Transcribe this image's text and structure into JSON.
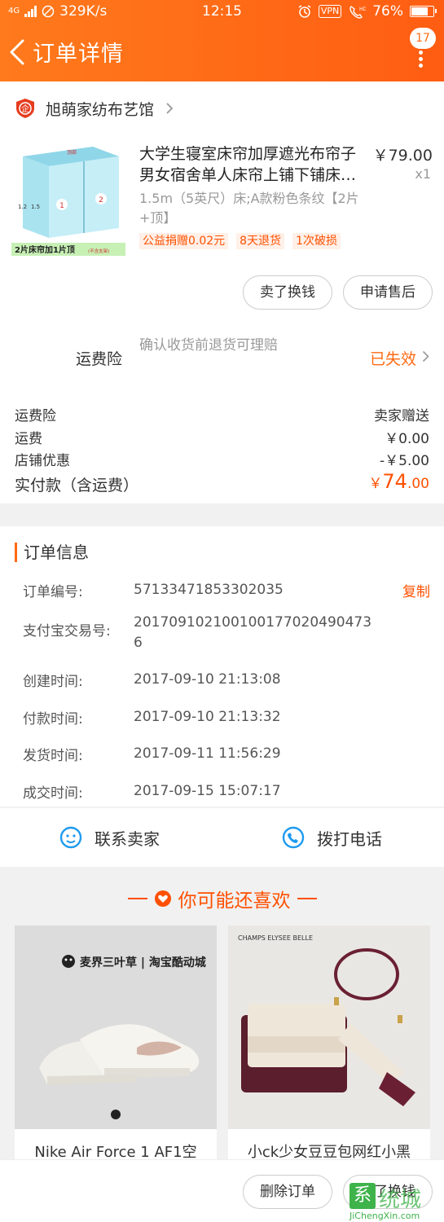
{
  "status_bar": {
    "network": "4G",
    "speed": "329K/s",
    "time": "12:15",
    "vpn": "VPN",
    "battery": "76%"
  },
  "header": {
    "title": "订单详情",
    "badge_count": "17",
    "accent_color": "#ff6a14"
  },
  "shop": {
    "name": "旭萌家纺布艺馆",
    "logo_text": "企"
  },
  "product": {
    "title": "大学生寝室床帘加厚遮光布帘子男女宿舍单人床帘上铺下铺床…",
    "price": "￥79.00",
    "qty": "x1",
    "sku": "1.5m（5英尺）床;A款粉色条纹【2片+顶】",
    "image_caption": "2片床帘加1片顶",
    "image_caption_note": "(不含支架)",
    "image_top_label": "顶部",
    "tags": [
      "公益捐赠0.02元",
      "8天退货",
      "1次破损"
    ]
  },
  "actions": {
    "sell_exchange": "卖了换钱",
    "after_sale": "申请售后"
  },
  "insurance": {
    "label": "运费险",
    "desc": "确认收货前退货可理赔",
    "status": "已失效"
  },
  "fees": [
    {
      "label": "运费险",
      "value": "卖家赠送"
    },
    {
      "label": "运费",
      "value": "￥0.00"
    },
    {
      "label": "店铺优惠",
      "value": "-￥5.00"
    }
  ],
  "total": {
    "label": "实付款（含运费）",
    "currency": "￥",
    "integer": "74",
    "decimal": ".00"
  },
  "order_info": {
    "title": "订单信息",
    "copy_label": "复制",
    "rows": [
      {
        "key": "订单编号:",
        "value": "57133471853302035"
      },
      {
        "key": "支付宝交易号:",
        "value": "2017091021001001770204904736"
      },
      {
        "key": "创建时间:",
        "value": "2017-09-10 21:13:08"
      },
      {
        "key": "付款时间:",
        "value": "2017-09-10 21:13:32"
      },
      {
        "key": "发货时间:",
        "value": "2017-09-11 11:56:29"
      },
      {
        "key": "成交时间:",
        "value": "2017-09-15 15:07:17"
      }
    ]
  },
  "contact": {
    "seller": "联系卖家",
    "phone": "拨打电话"
  },
  "recommend": {
    "title": "你可能还喜欢",
    "items": [
      {
        "title": "Nike Air Force 1 AF1空",
        "brand_text": "麦界三叶草 | 淘宝酷动城"
      },
      {
        "title": "小ck少女豆豆包网红小黑",
        "brand_text": "CHAMPS ELYSEE BELLE"
      }
    ]
  },
  "bottom": {
    "delete_order": "删除订单",
    "sell_exchange": "卖了换钱"
  },
  "watermark": {
    "logo": "系",
    "name": "统城",
    "url": "JiChengXin.com"
  }
}
